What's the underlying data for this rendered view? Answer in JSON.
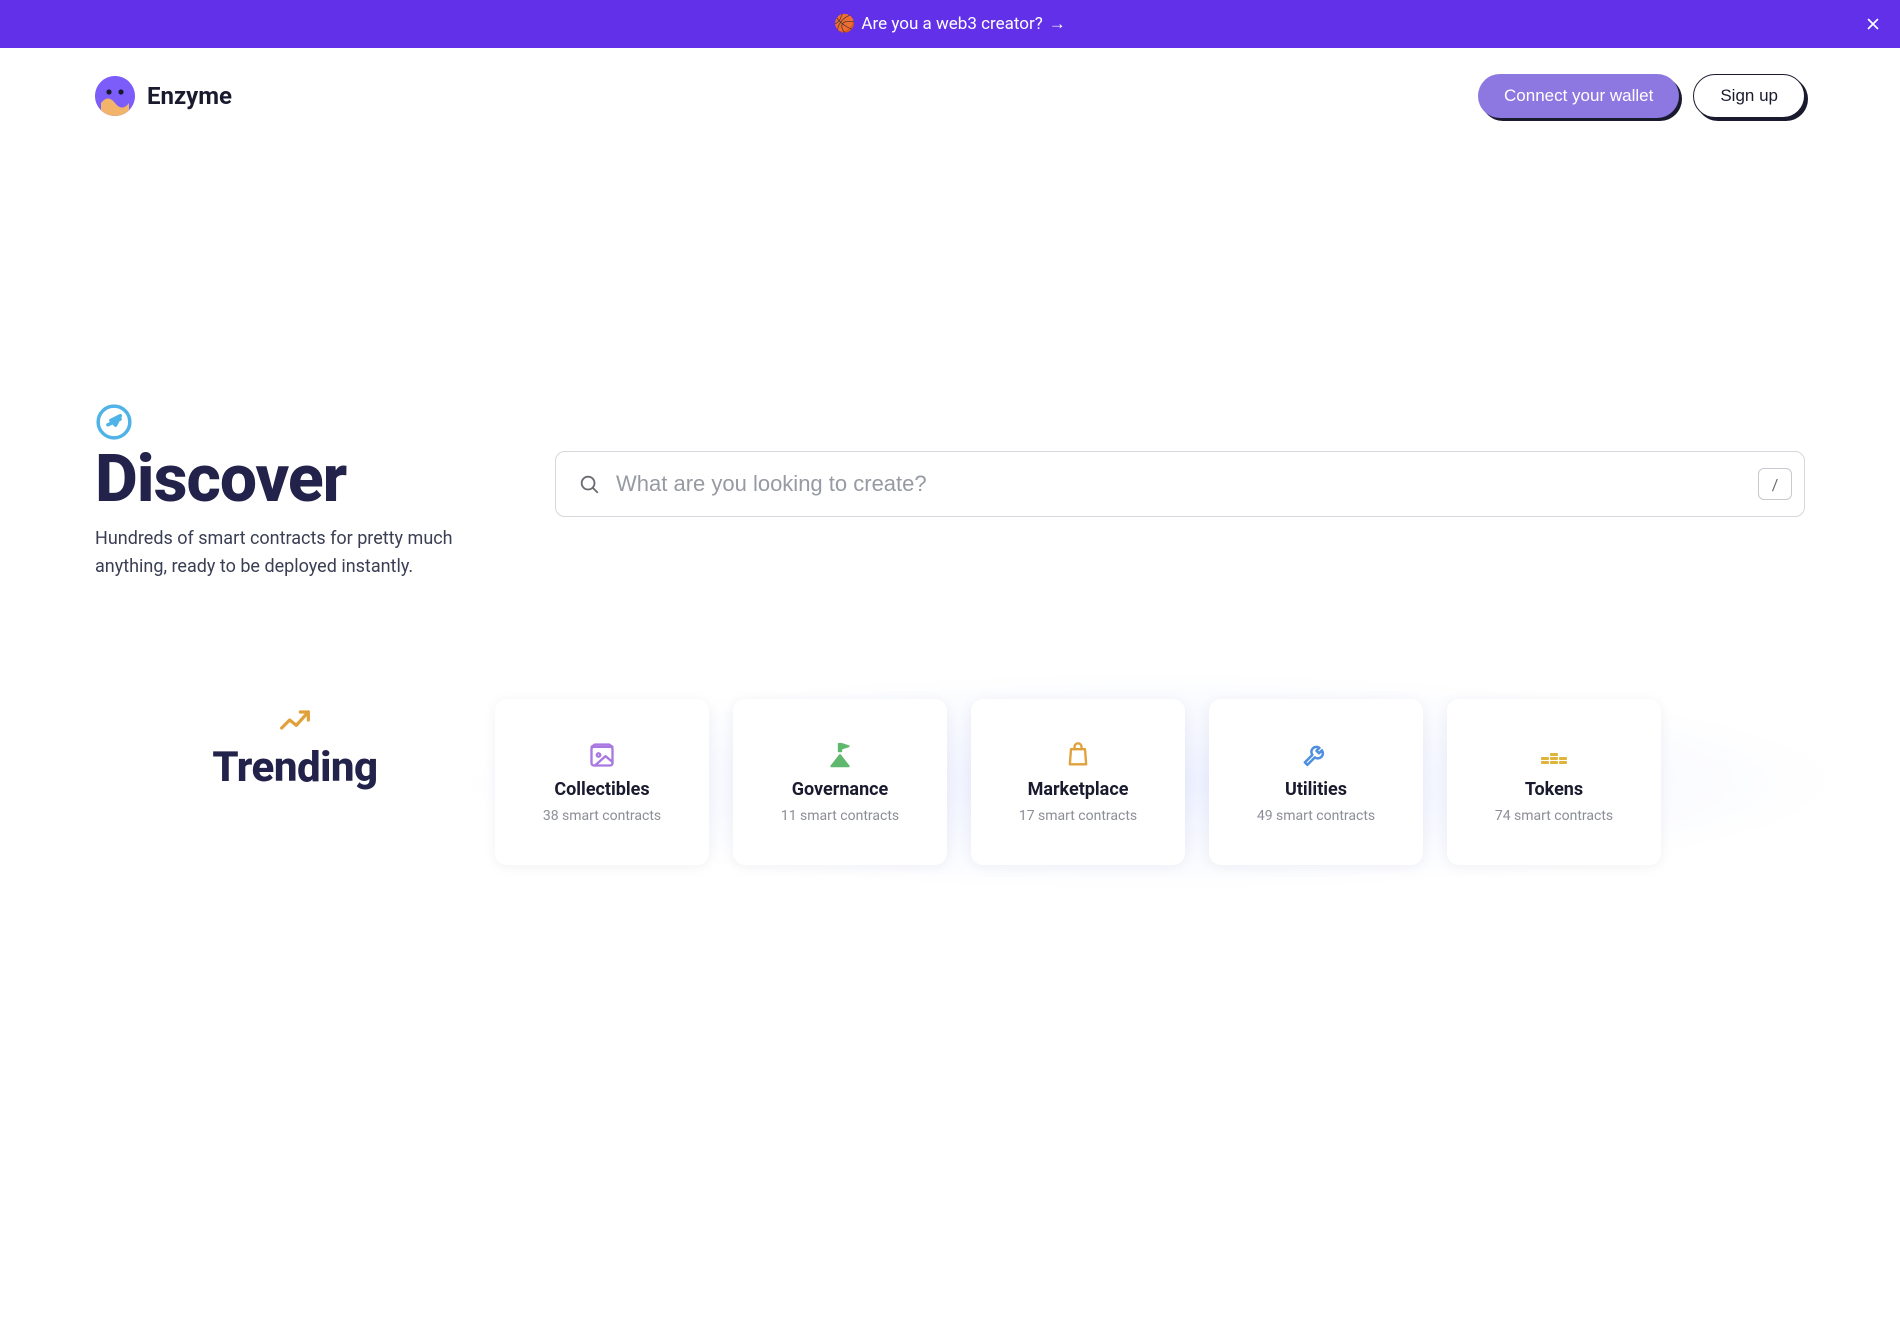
{
  "banner": {
    "emoji": "🏀",
    "text": "Are you a web3 creator?",
    "arrow": "→"
  },
  "header": {
    "brand": "Enzyme",
    "connect_label": "Connect your wallet",
    "signup_label": "Sign up"
  },
  "discover": {
    "title": "Discover",
    "subtitle": "Hundreds of smart contracts for pretty much anything, ready to be deployed instantly."
  },
  "search": {
    "placeholder": "What are you looking to create?",
    "slash": "/"
  },
  "trending": {
    "title": "Trending",
    "cards": [
      {
        "icon": "image-icon",
        "color": "#a978e0",
        "title": "Collectibles",
        "sub": "38 smart contracts"
      },
      {
        "icon": "flag-icon",
        "color": "#5fb86e",
        "title": "Governance",
        "sub": "11 smart contracts"
      },
      {
        "icon": "bag-icon",
        "color": "#e0a03b",
        "title": "Marketplace",
        "sub": "17 smart contracts"
      },
      {
        "icon": "wrench-icon",
        "color": "#4f8fe0",
        "title": "Utilities",
        "sub": "49 smart contracts"
      },
      {
        "icon": "coins-icon",
        "color": "#e0b33b",
        "title": "Tokens",
        "sub": "74 smart contracts"
      }
    ]
  }
}
